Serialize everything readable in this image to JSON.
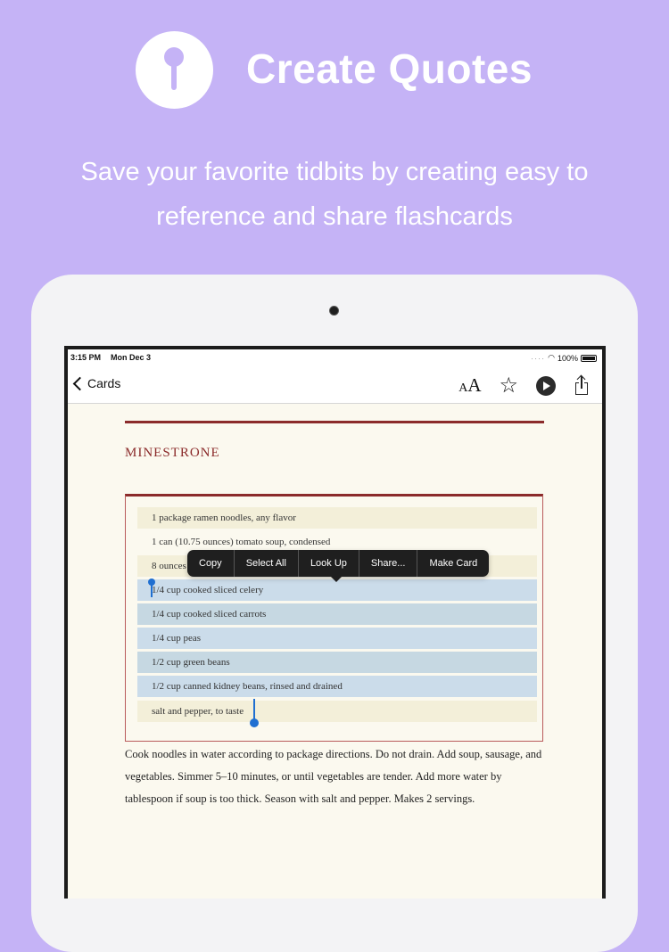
{
  "hero": {
    "title": "Create Quotes",
    "subtitle": "Save your favorite tidbits by creating easy to reference and share flashcards"
  },
  "colors": {
    "background": "#c5b3f6",
    "accent": "#8b2b2b",
    "selection": "#cbdcea",
    "caret": "#1f6fd1"
  },
  "statusbar": {
    "time": "3:15 PM",
    "date": "Mon Dec 3",
    "battery": "100%"
  },
  "navbar": {
    "back_label": "Cards",
    "text_size_small": "A",
    "text_size_large": "A",
    "icons": [
      "text-size-icon",
      "star-icon",
      "play-icon",
      "share-icon"
    ]
  },
  "recipe": {
    "title": "MINESTRONE",
    "ingredients": [
      "1 package ramen noodles, any flavor",
      "1 can (10.75 ounces) tomato soup, condensed",
      "8 ounces",
      "1/4 cup cooked sliced celery",
      "1/4 cup cooked sliced carrots",
      "1/4 cup peas",
      "1/2 cup green beans",
      "1/2 cup canned kidney beans, rinsed and drained",
      "salt and pepper, to taste"
    ],
    "directions": "Cook noodles in water according to package directions. Do not drain. Add soup, sausage, and vegetables. Simmer 5–10 minutes, or until vegetables are tender. Add more water by tablespoon if soup is too thick. Season with salt and pepper. Makes 2 servings."
  },
  "context_menu": {
    "items": [
      "Copy",
      "Select All",
      "Look Up",
      "Share...",
      "Make Card"
    ]
  }
}
